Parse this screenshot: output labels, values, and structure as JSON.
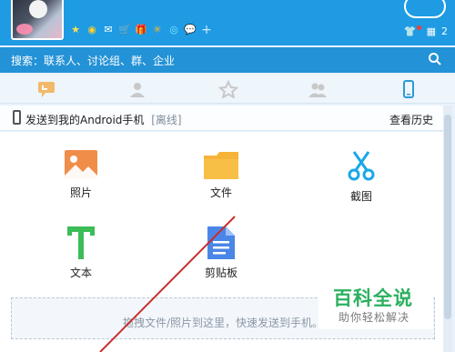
{
  "header": {
    "apps": [
      "star-icon",
      "ring-icon",
      "mail-icon",
      "cart-icon",
      "gift-icon",
      "game-icon",
      "swirl-icon",
      "chat-icon",
      "plus-icon"
    ],
    "right_count": "2"
  },
  "search": {
    "placeholder": "搜索：联系人、讨论组、群、企业"
  },
  "tabs": [
    "conversation-icon",
    "contact-icon",
    "favorite-icon",
    "group-icon",
    "phone-icon"
  ],
  "device": {
    "title": "发送到我的Android手机",
    "status": "[离线]",
    "history": "查看历史"
  },
  "tiles": [
    {
      "label": "照片",
      "icon": "image-icon"
    },
    {
      "label": "文件",
      "icon": "folder-icon"
    },
    {
      "label": "截图",
      "icon": "scissors-icon"
    },
    {
      "label": "文本",
      "icon": "text-icon"
    },
    {
      "label": "剪贴板",
      "icon": "clipboard-icon"
    }
  ],
  "dropzone": {
    "text": "拖拽文件/照片到这里，快速发送到手机。"
  },
  "watermark": {
    "title": "百科全说",
    "subtitle": "助你轻松解决"
  }
}
